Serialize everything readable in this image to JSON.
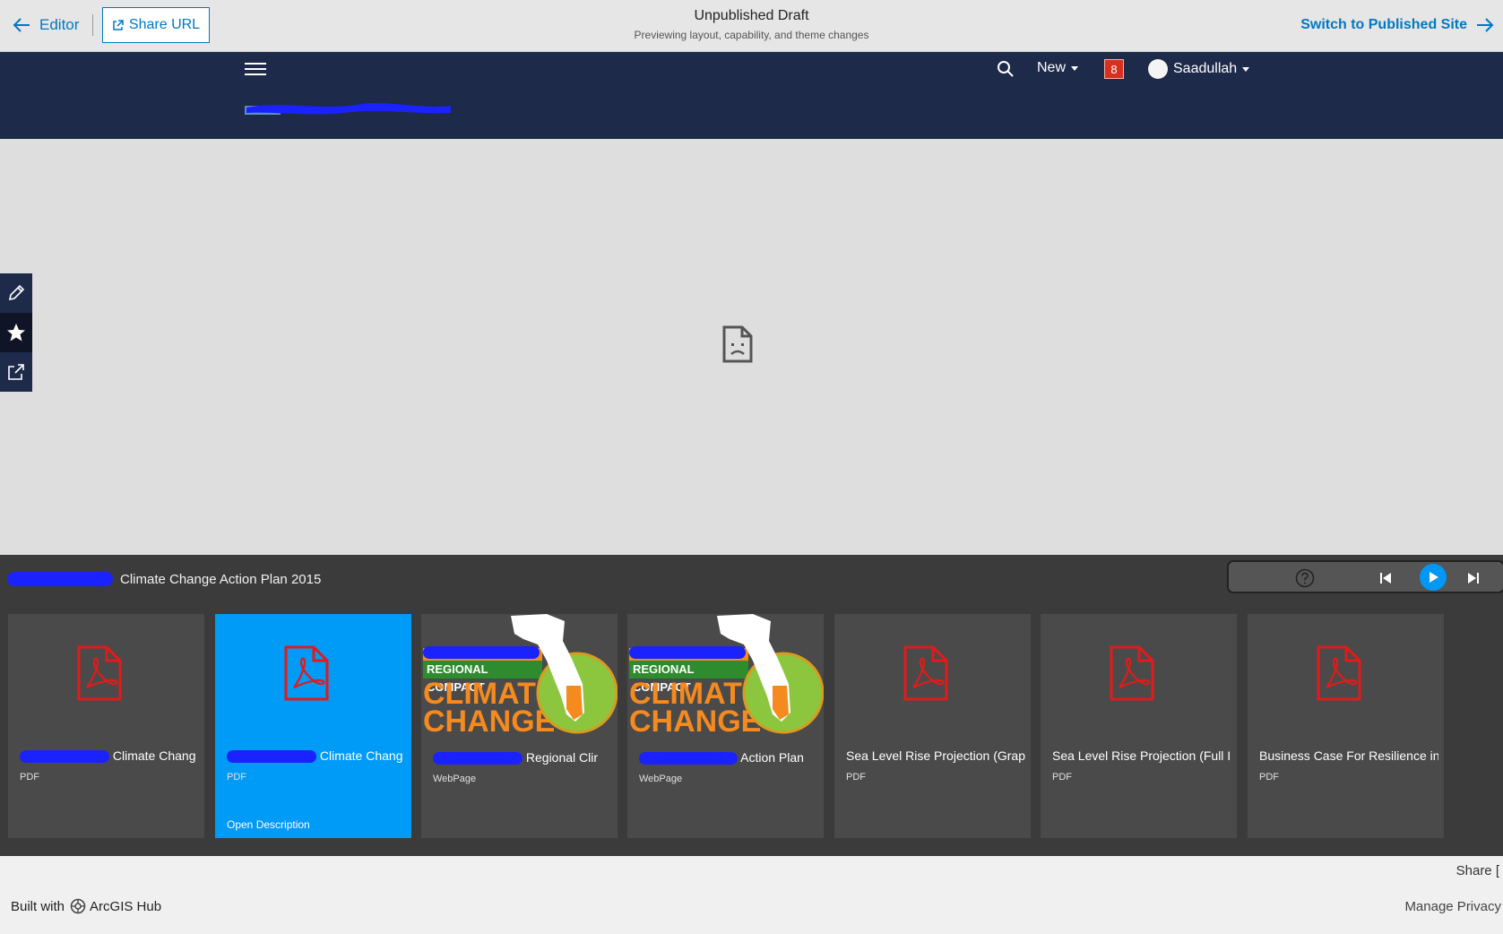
{
  "preview_bar": {
    "editor_label": "Editor",
    "share_url_label": "Share URL",
    "title": "Unpublished Draft",
    "subtitle": "Previewing layout, capability, and theme changes",
    "switch_label": "Switch to Published Site"
  },
  "header": {
    "new_label": "New",
    "notification_count": "8",
    "user_name": "Saadullah",
    "background": "#1e2a4a"
  },
  "gallery": {
    "title": "Climate Change Action Plan 2015",
    "cards": [
      {
        "title": "Climate Chang",
        "type": "PDF",
        "icon": "pdf-icon"
      },
      {
        "title": "Climate Chang",
        "type": "PDF",
        "icon": "pdf-icon",
        "open_description": "Open Description",
        "selected_color": "#009af7"
      },
      {
        "title": "Regional Clir",
        "type": "WebPage",
        "thumb_band": "REGIONAL COMPACT",
        "thumb_big": "CLIMATE CHANGE"
      },
      {
        "title": "Action Plan",
        "type": "WebPage",
        "thumb_band": "REGIONAL COMPACT",
        "thumb_big": "CLIMATE CHANGE"
      },
      {
        "title": "Sea Level Rise Projection (Grap",
        "type": "PDF",
        "icon": "pdf-icon"
      },
      {
        "title": "Sea Level Rise Projection (Full I",
        "type": "PDF",
        "icon": "pdf-icon"
      },
      {
        "title": "Business Case For Resilience in",
        "type": "PDF",
        "icon": "pdf-icon"
      }
    ]
  },
  "footer": {
    "share_label": "Share",
    "built_with": "Built with",
    "brand": "ArcGIS Hub",
    "privacy_label": "Manage Privacy"
  }
}
